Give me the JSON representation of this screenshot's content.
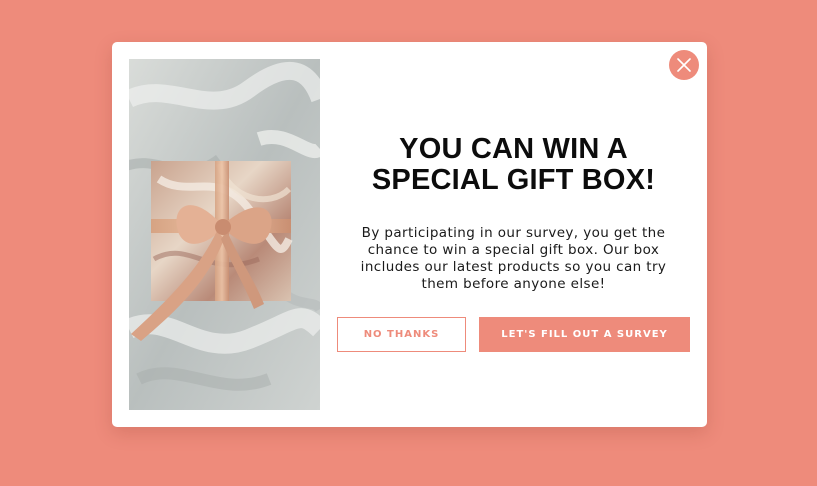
{
  "theme": {
    "backdrop_color": "#ee8b7b",
    "accent_color": "#ee8b7b",
    "modal_color": "#ffffff",
    "text_color": "#0c0c0c"
  },
  "modal": {
    "image_icon": "gift-box-photo",
    "close_icon": "close-x-icon",
    "headline_line1": "YOU CAN WIN A",
    "headline_line2": "SPECIAL GIFT BOX!",
    "body_line1": "By participating in our survey, you get the",
    "body_line2": "chance to win a special gift box. Our box",
    "body_line3": "includes our latest products so you can try",
    "body_line4": "them before anyone else!",
    "decline_label": "NO THANKS",
    "accept_label": "LET'S FILL OUT A SURVEY"
  }
}
